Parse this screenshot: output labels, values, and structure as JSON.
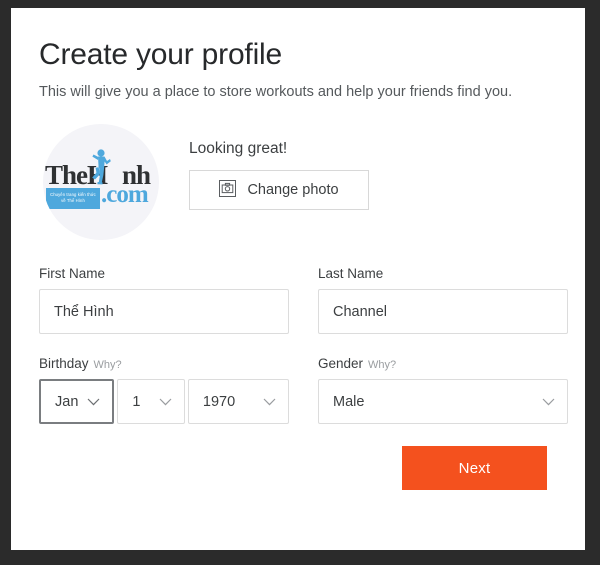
{
  "page": {
    "title": "Create your profile",
    "subtitle": "This will give you a place to store workouts and help your friends find you."
  },
  "photo": {
    "status_text": "Looking great!",
    "change_button_label": "Change photo",
    "camera_icon": "camera-icon",
    "avatar_logo": {
      "wordmark_part1": "TheH",
      "wordmark_part2": "nh",
      "dotcom": ".com",
      "banner_line1": "Chuyên trang kiến thức",
      "banner_line2": "về Thể Hình",
      "brand_blue": "#4ea8dd",
      "brand_dark": "#2f3133"
    }
  },
  "form": {
    "first_name": {
      "label": "First Name",
      "value": "Thể Hình",
      "placeholder": "First Name"
    },
    "last_name": {
      "label": "Last Name",
      "value": "Channel",
      "placeholder": "Last Name"
    },
    "birthday": {
      "label": "Birthday",
      "why_label": "Why?",
      "month": "Jan",
      "day": "1",
      "year": "1970"
    },
    "gender": {
      "label": "Gender",
      "why_label": "Why?",
      "value": "Male"
    }
  },
  "footer": {
    "next_label": "Next",
    "next_color": "#f4511e"
  },
  "colors": {
    "frame": "#2b2b2b",
    "card": "#ffffff",
    "border": "#dcdcdc",
    "text": "#3c3f41",
    "muted": "#9a9da0",
    "accent": "#f4511e",
    "avatar_bg": "#f4f4f8"
  }
}
